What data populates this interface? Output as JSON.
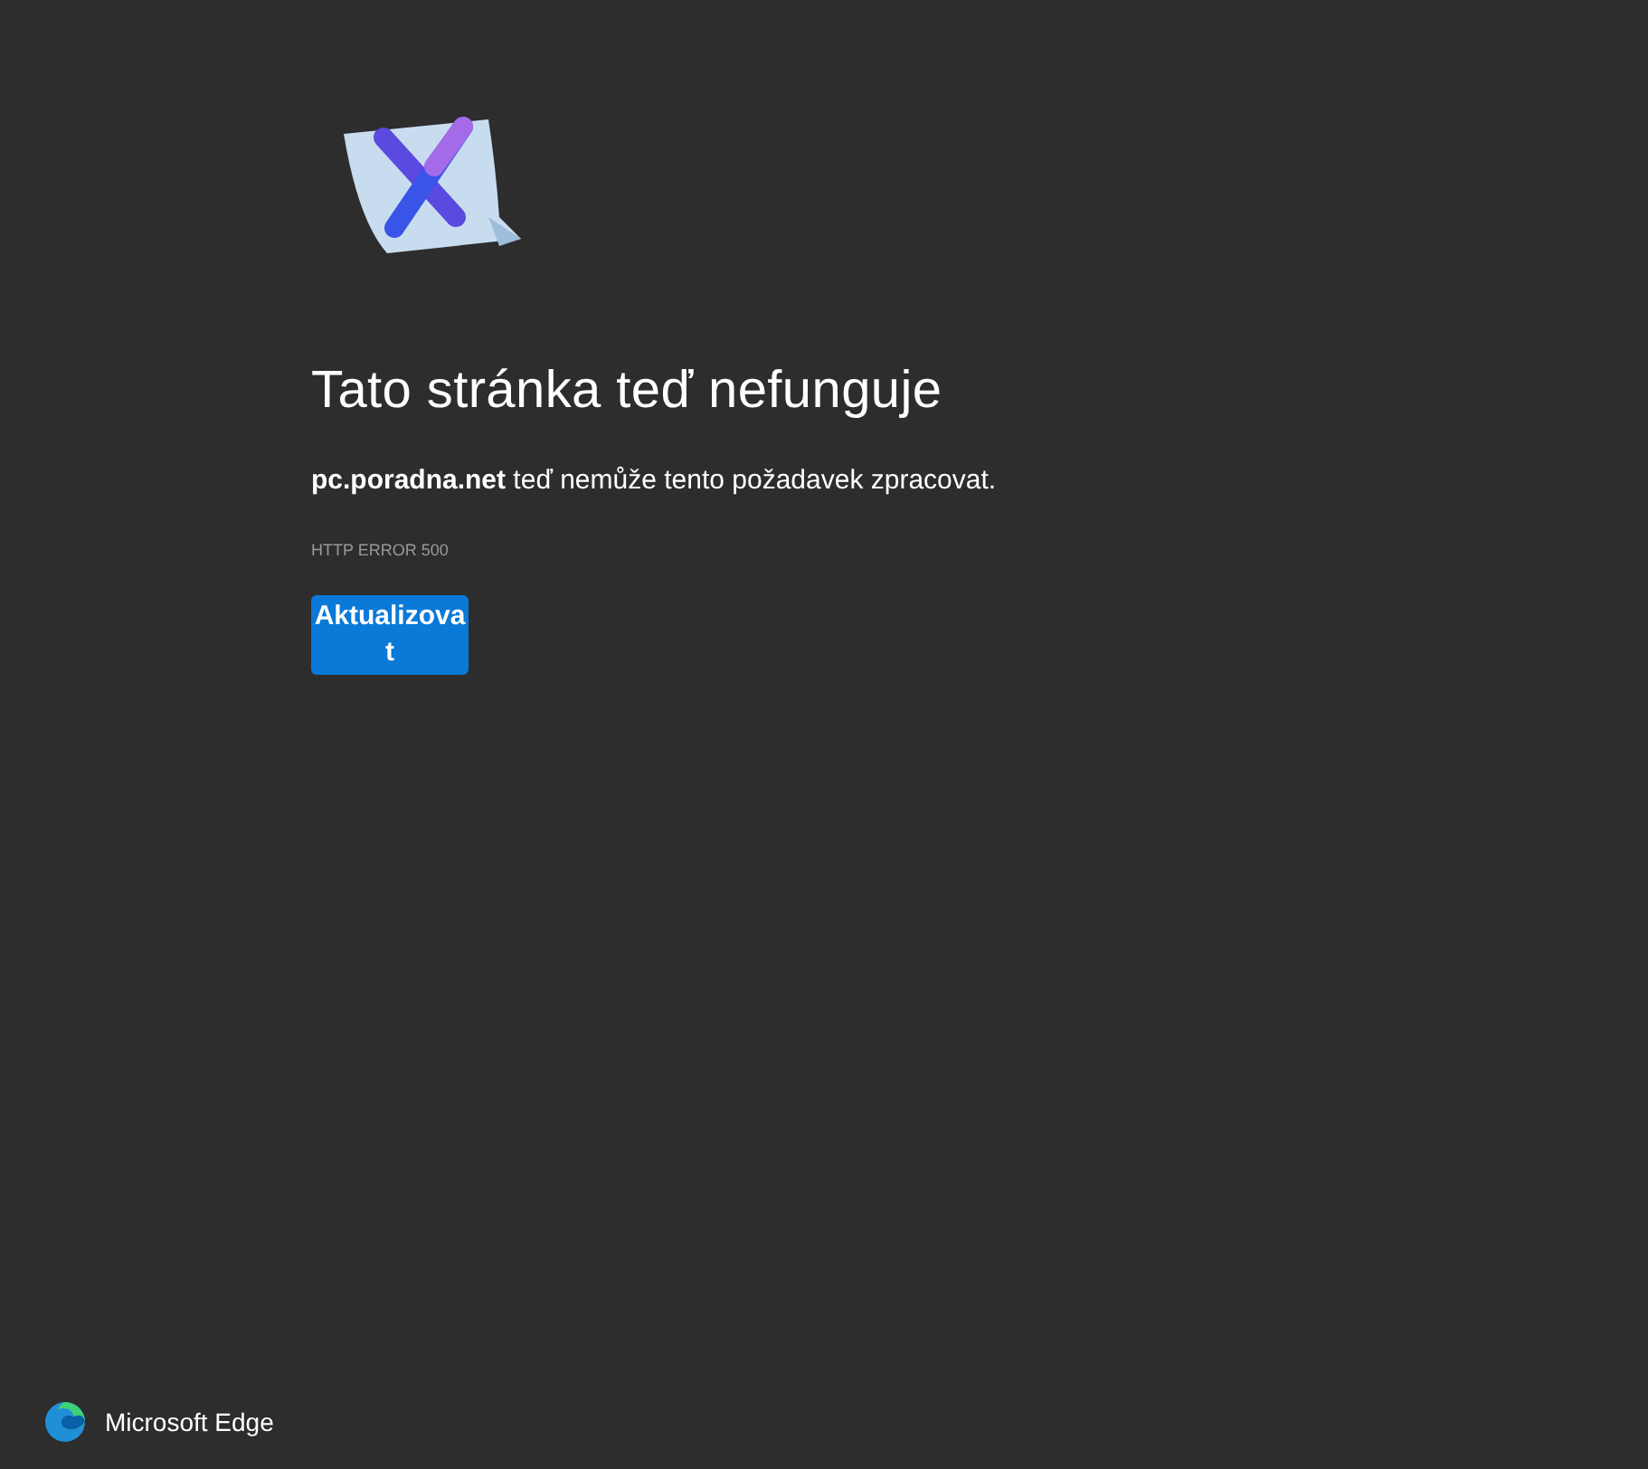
{
  "heading": "Tato stránka teď nefunguje",
  "message": "**pc.poradna.net** teď nemůže tento požadavek zpracovat.",
  "error_code": "HTTP ERROR 500",
  "reload_button": "Aktualizovat",
  "footer": {
    "brand": "Microsoft Edge"
  }
}
